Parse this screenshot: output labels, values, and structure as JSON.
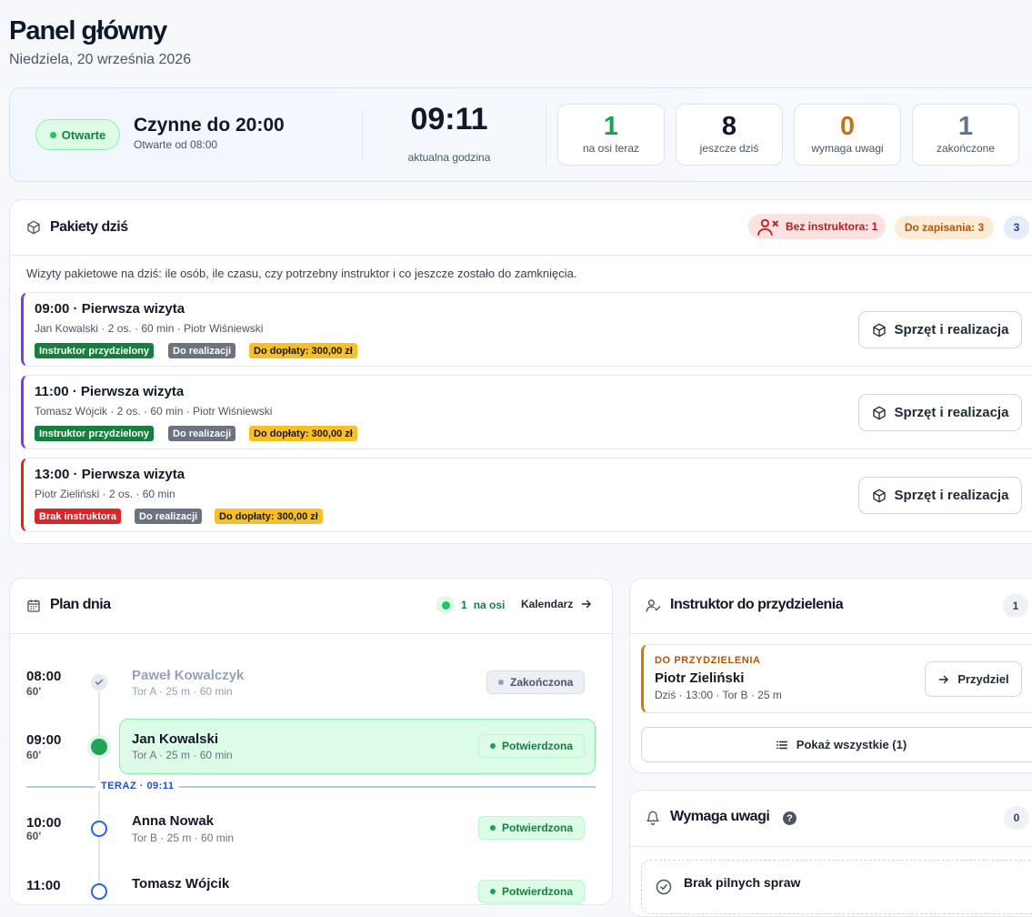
{
  "header": {
    "title": "Panel główny",
    "date": "Niedziela, 20 września 2026"
  },
  "status": {
    "open_pill": "Otwarte",
    "hours_title": "Czynne do 20:00",
    "hours_sub": "Otwarte od 08:00",
    "clock": "09:11",
    "clock_label": "aktualna godzina",
    "stats": [
      {
        "value": "1",
        "label": "na osi teraz",
        "color": "#16a34a"
      },
      {
        "value": "8",
        "label": "jeszcze dziś",
        "color": "#111827"
      },
      {
        "value": "0",
        "label": "wymaga uwagi",
        "color": "#c2741c"
      },
      {
        "value": "1",
        "label": "zakończone",
        "color": "#64748b"
      }
    ]
  },
  "packages": {
    "title": "Pakiety dziś",
    "badge_no_instructor": "Bez instruktora: 1",
    "badge_to_save": "Do zapisania: 3",
    "badge_count": "3",
    "description": "Wizyty pakietowe na dziś: ile osób, ile czasu, czy potrzebny instruktor i co jeszcze zostało do zamknięcia.",
    "button_label": "Sprzęt i realizacja",
    "visits": [
      {
        "title": "09:00 · Pierwsza wizyta",
        "meta": "Jan Kowalski · 2 os. · 60 min · Piotr Wiśniewski",
        "tag1": "Instruktor przydzielony",
        "tag2": "Do realizacji",
        "tag3": "Do dopłaty: 300,00 zł"
      },
      {
        "title": "11:00 · Pierwsza wizyta",
        "meta": "Tomasz Wójcik · 2 os. · 60 min · Piotr Wiśniewski",
        "tag1": "Instruktor przydzielony",
        "tag2": "Do realizacji",
        "tag3": "Do dopłaty: 300,00 zł"
      },
      {
        "title": "13:00 · Pierwsza wizyta",
        "meta": "Piotr Zieliński · 2 os. · 60 min",
        "tag1": "Brak instruktora",
        "tag2": "Do realizacji",
        "tag3": "Do dopłaty: 300,00 zł"
      }
    ]
  },
  "plan": {
    "title": "Plan dnia",
    "on_axis_count": "1",
    "on_axis_label": "na osi",
    "calendar": "Kalendarz",
    "now_label": "TERAZ · 09:11",
    "items": [
      {
        "time": "08:00",
        "dur": "60'",
        "name": "Paweł Kowalczyk",
        "sub": "Tor A · 25 m · 60 min",
        "status": "Zakończona"
      },
      {
        "time": "09:00",
        "dur": "60'",
        "name": "Jan Kowalski",
        "sub": "Tor A · 25 m · 60 min",
        "status": "Potwierdzona"
      },
      {
        "time": "10:00",
        "dur": "60'",
        "name": "Anna Nowak",
        "sub": "Tor B · 25 m · 60 min",
        "status": "Potwierdzona"
      },
      {
        "time": "11:00",
        "dur": "",
        "name": "Tomasz Wójcik",
        "sub": "",
        "status": "Potwierdzona"
      }
    ]
  },
  "instructor": {
    "title": "Instruktor do przydzielenia",
    "count": "1",
    "kicker": "DO PRZYDZIELENIA",
    "name": "Piotr Zieliński",
    "meta": "Dziś · 13:00 · Tor B · 25 m",
    "assign_button": "Przydziel",
    "show_all": "Pokaż wszystkie (1)"
  },
  "attention": {
    "title": "Wymaga uwagi",
    "count": "0",
    "empty_title": "Brak pilnych spraw"
  }
}
